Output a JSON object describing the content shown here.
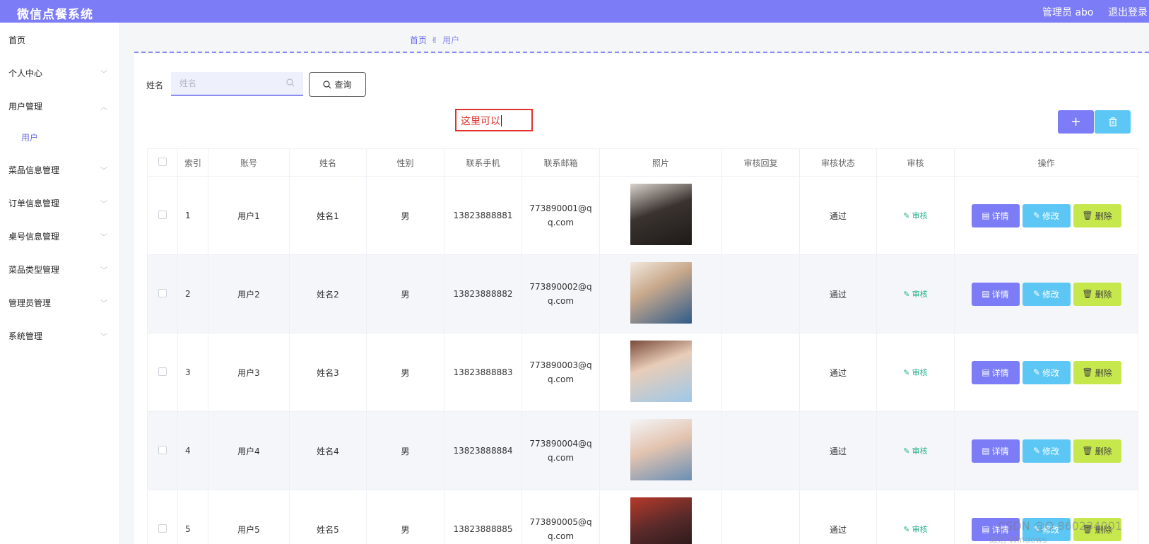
{
  "header": {
    "title": "微信点餐系统",
    "admin_label": "管理员 abo",
    "logout_label": "退出登录"
  },
  "sidebar": {
    "items": [
      {
        "label": "首页",
        "expandable": false
      },
      {
        "label": "个人中心",
        "expandable": true
      },
      {
        "label": "用户管理",
        "expandable": true,
        "expanded": true
      },
      {
        "label": "菜品信息管理",
        "expandable": true
      },
      {
        "label": "订单信息管理",
        "expandable": true
      },
      {
        "label": "桌号信息管理",
        "expandable": true
      },
      {
        "label": "菜品类型管理",
        "expandable": true
      },
      {
        "label": "管理员管理",
        "expandable": true
      },
      {
        "label": "系统管理",
        "expandable": true
      }
    ],
    "sub_items": [
      {
        "label": "用户"
      }
    ]
  },
  "breadcrumb": {
    "home": "首页",
    "current": "用户",
    "separator_icon": "hand-icon"
  },
  "search": {
    "label": "姓名",
    "placeholder": "姓名",
    "value": "",
    "query_button": "查询"
  },
  "annotation": {
    "text": "这里可以"
  },
  "toolbar": {
    "add_label": "+",
    "delete_icon": "trash-icon"
  },
  "table": {
    "columns": [
      "",
      "索引",
      "账号",
      "姓名",
      "性别",
      "联系手机",
      "联系邮箱",
      "照片",
      "审核回复",
      "审核状态",
      "审核",
      "操作"
    ],
    "audit_label": "审核",
    "actions": {
      "detail": "详情",
      "edit": "修改",
      "delete": "删除"
    },
    "rows": [
      {
        "index": "1",
        "account": "用户1",
        "name": "姓名1",
        "gender": "男",
        "phone": "13823888881",
        "email": "773890001@qq.com",
        "reply": "",
        "status": "通过"
      },
      {
        "index": "2",
        "account": "用户2",
        "name": "姓名2",
        "gender": "男",
        "phone": "13823888882",
        "email": "773890002@qq.com",
        "reply": "",
        "status": "通过"
      },
      {
        "index": "3",
        "account": "用户3",
        "name": "姓名3",
        "gender": "男",
        "phone": "13823888883",
        "email": "773890003@qq.com",
        "reply": "",
        "status": "通过"
      },
      {
        "index": "4",
        "account": "用户4",
        "name": "姓名4",
        "gender": "男",
        "phone": "13823888884",
        "email": "773890004@qq.com",
        "reply": "",
        "status": "通过"
      },
      {
        "index": "5",
        "account": "用户5",
        "name": "姓名5",
        "gender": "男",
        "phone": "13823888885",
        "email": "773890005@qq.com",
        "reply": "",
        "status": "通过"
      }
    ]
  },
  "watermark": {
    "text": "CSDN @Q 860234001",
    "activate_text": "激活 Windows"
  },
  "colors": {
    "primary": "#7b7cf6",
    "info": "#5cc7f4",
    "warning": "#c7e84c",
    "success_text": "#25b38a",
    "annotation": "#e0322b"
  }
}
